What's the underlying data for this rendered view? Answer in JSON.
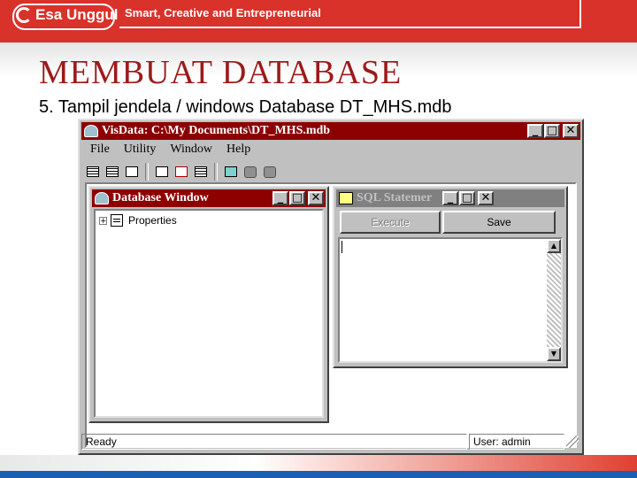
{
  "slide": {
    "brand": "Esa Unggul",
    "tagline": "Smart, Creative and Entrepreneurial",
    "title": "MEMBUAT  DATABASE",
    "subtitle": "5. Tampil jendela / windows Database  DT_MHS.mdb"
  },
  "app": {
    "title": "VisData: C:\\My Documents\\DT_MHS.mdb",
    "menu": [
      "File",
      "Utility",
      "Window",
      "Help"
    ],
    "toolbar_icons": [
      "table-icon",
      "dynaset-icon",
      "snapshot-icon",
      "data-control-icon",
      "dbgrid-icon",
      "grid-icon",
      "begin-trans-icon",
      "commit-icon",
      "rollback-icon"
    ],
    "status": {
      "left": "Ready",
      "right": "User: admin"
    }
  },
  "db_window": {
    "title": "Database Window",
    "tree": [
      {
        "label": "Properties",
        "expander": "+"
      }
    ]
  },
  "sql_window": {
    "title": "SQL Statemer",
    "execute_label": "Execute",
    "save_label": "Save",
    "text": ""
  },
  "glyphs": {
    "minimize": "_",
    "maximize": "□",
    "close": "✕",
    "up": "▲",
    "down": "▼"
  },
  "colors": {
    "title_active": "#8c0000",
    "title_inactive": "#808080",
    "face": "#c0c0c0",
    "brand_red": "#d8322a",
    "heading": "#9c1a1a"
  }
}
